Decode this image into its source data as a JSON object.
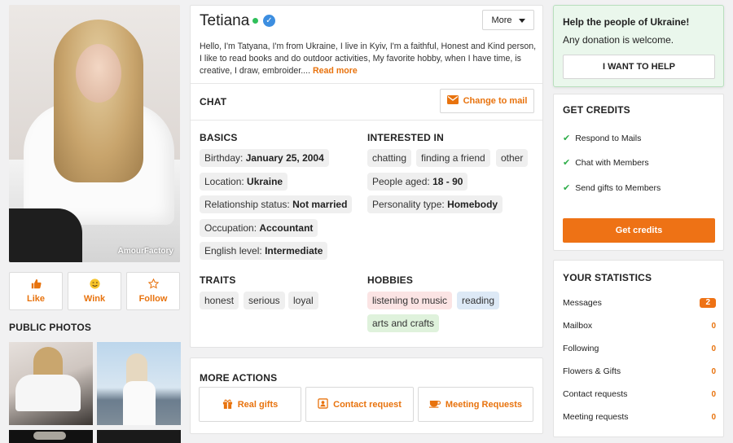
{
  "profile": {
    "name": "Tetiana",
    "watermark": "AmourFactory",
    "more_label": "More",
    "bio": "Hello, I'm Tatyana, I'm from Ukraine, I live in Kyiv, I'm a faithful, Honest and Kind person, I like to read books and do outdoor activities, My favorite hobby, when I have time, is creative, I draw, embroider....",
    "read_more": "Read more"
  },
  "actions": {
    "like": "Like",
    "wink": "Wink",
    "follow": "Follow"
  },
  "public_photos_title": "PUBLIC PHOTOS",
  "chat": {
    "title": "CHAT",
    "change_to_mail": "Change to mail"
  },
  "basics": {
    "title": "BASICS",
    "items": [
      {
        "label": "Birthday:",
        "value": "January 25, 2004"
      },
      {
        "label": "Location:",
        "value": "Ukraine"
      },
      {
        "label": "Relationship status:",
        "value": "Not married"
      },
      {
        "label": "Occupation:",
        "value": "Accountant"
      },
      {
        "label": "English level:",
        "value": "Intermediate"
      }
    ]
  },
  "interested_in": {
    "title": "INTERESTED IN",
    "tags": [
      "chatting",
      "finding a friend",
      "other"
    ],
    "age_label": "People aged:",
    "age_value": "18 - 90",
    "personality_label": "Personality type:",
    "personality_value": "Homebody"
  },
  "traits": {
    "title": "TRAITS",
    "items": [
      "honest",
      "serious",
      "loyal"
    ]
  },
  "hobbies": {
    "title": "HOBBIES",
    "items": [
      "listening to music",
      "reading",
      "arts and crafts"
    ]
  },
  "more_actions": {
    "title": "MORE ACTIONS",
    "real_gifts": "Real gifts",
    "contact_request": "Contact request",
    "meeting_requests": "Meeting Requests"
  },
  "help": {
    "title": "Help the people of Ukraine!",
    "subtitle": "Any donation is welcome.",
    "button": "I WANT TO HELP"
  },
  "credits": {
    "title": "GET CREDITS",
    "items": [
      "Respond to Mails",
      "Chat with Members",
      "Send gifts to Members"
    ],
    "button": "Get credits"
  },
  "statistics": {
    "title": "YOUR STATISTICS",
    "rows": [
      {
        "label": "Messages",
        "value": "2"
      },
      {
        "label": "Mailbox",
        "value": "0"
      },
      {
        "label": "Following",
        "value": "0"
      },
      {
        "label": "Flowers & Gifts",
        "value": "0"
      },
      {
        "label": "Contact requests",
        "value": "0"
      },
      {
        "label": "Meeting requests",
        "value": "0"
      }
    ]
  },
  "colors": {
    "accent": "#ee7215",
    "online": "#2fbf5a",
    "verified": "#3d8ee0",
    "help_bg": "#eaf7ec"
  }
}
